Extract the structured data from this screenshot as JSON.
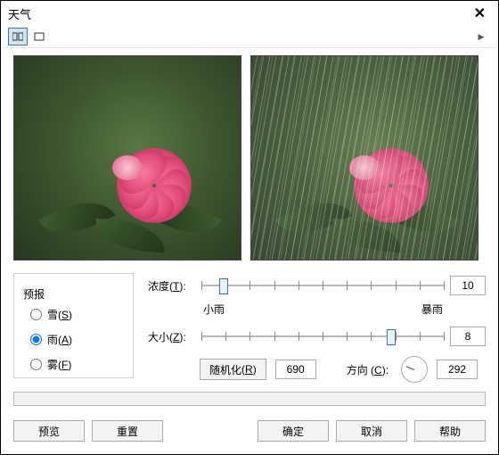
{
  "window": {
    "title": "天气"
  },
  "toolbar": {
    "play_icon": "▶"
  },
  "forecast": {
    "legend": "预报",
    "options": {
      "snow": {
        "label": "雪",
        "accel": "S",
        "checked": false
      },
      "rain": {
        "label": "雨",
        "accel": "A",
        "checked": true
      },
      "fog": {
        "label": "雾",
        "accel": "F",
        "checked": false
      }
    }
  },
  "sliders": {
    "density": {
      "label": "浓度",
      "accel": "T",
      "value": "10",
      "pos_pct": 9,
      "scale_min": "小雨",
      "scale_max": "暴雨"
    },
    "size": {
      "label": "大小",
      "accel": "Z",
      "value": "8",
      "pos_pct": 78
    }
  },
  "randomize": {
    "btn_label": "随机化",
    "btn_accel": "R",
    "seed": "690"
  },
  "direction": {
    "label": "方向",
    "accel": "C",
    "value": "292",
    "angle_deg": 292
  },
  "buttons": {
    "preview": "预览",
    "reset": "重置",
    "ok": "确定",
    "cancel": "取消",
    "help": "帮助"
  }
}
